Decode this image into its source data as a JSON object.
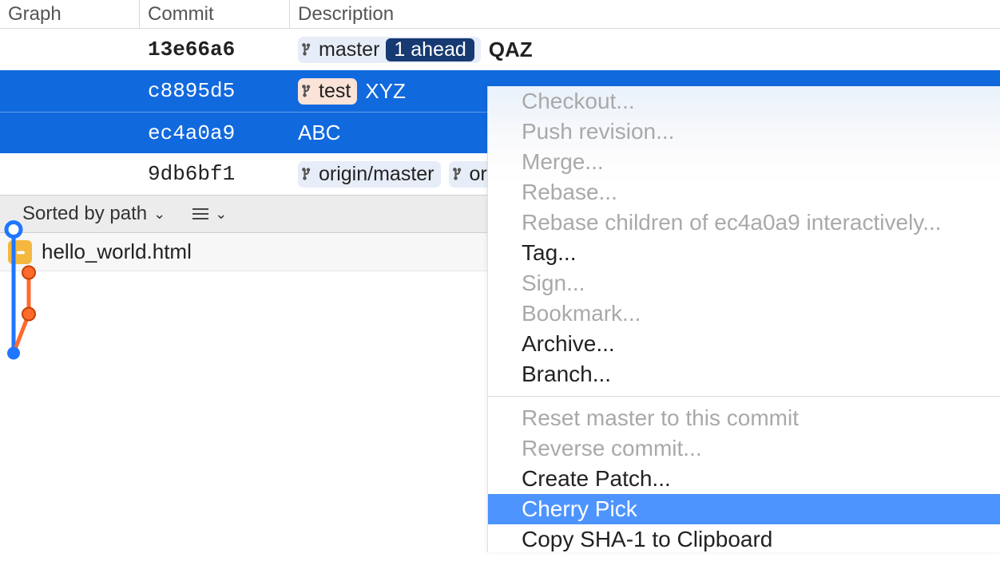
{
  "header": {
    "graph": "Graph",
    "commit": "Commit",
    "description": "Description"
  },
  "rows": [
    {
      "hash": "13e66a6",
      "branch": "master",
      "ahead": "1 ahead",
      "msg": "QAZ",
      "hash_bold": true
    },
    {
      "hash": "c8895d5",
      "branch": "test",
      "msg": "XYZ"
    },
    {
      "hash": "ec4a0a9",
      "msg": "ABC"
    },
    {
      "hash": "9db6bf1",
      "branch1": "origin/master",
      "branch2": "or"
    }
  ],
  "toolbar": {
    "sort": "Sorted by path"
  },
  "file": {
    "name": "hello_world.html"
  },
  "menu": {
    "checkout": "Checkout...",
    "push": "Push revision...",
    "merge": "Merge...",
    "rebase": "Rebase...",
    "rebase_children": "Rebase children of ec4a0a9 interactively...",
    "tag": "Tag...",
    "sign": "Sign...",
    "bookmark": "Bookmark...",
    "archive": "Archive...",
    "branch": "Branch...",
    "reset": "Reset master to this commit",
    "reverse": "Reverse commit...",
    "patch": "Create Patch...",
    "cherry": "Cherry Pick",
    "copysha": "Copy SHA-1 to Clipboard"
  }
}
